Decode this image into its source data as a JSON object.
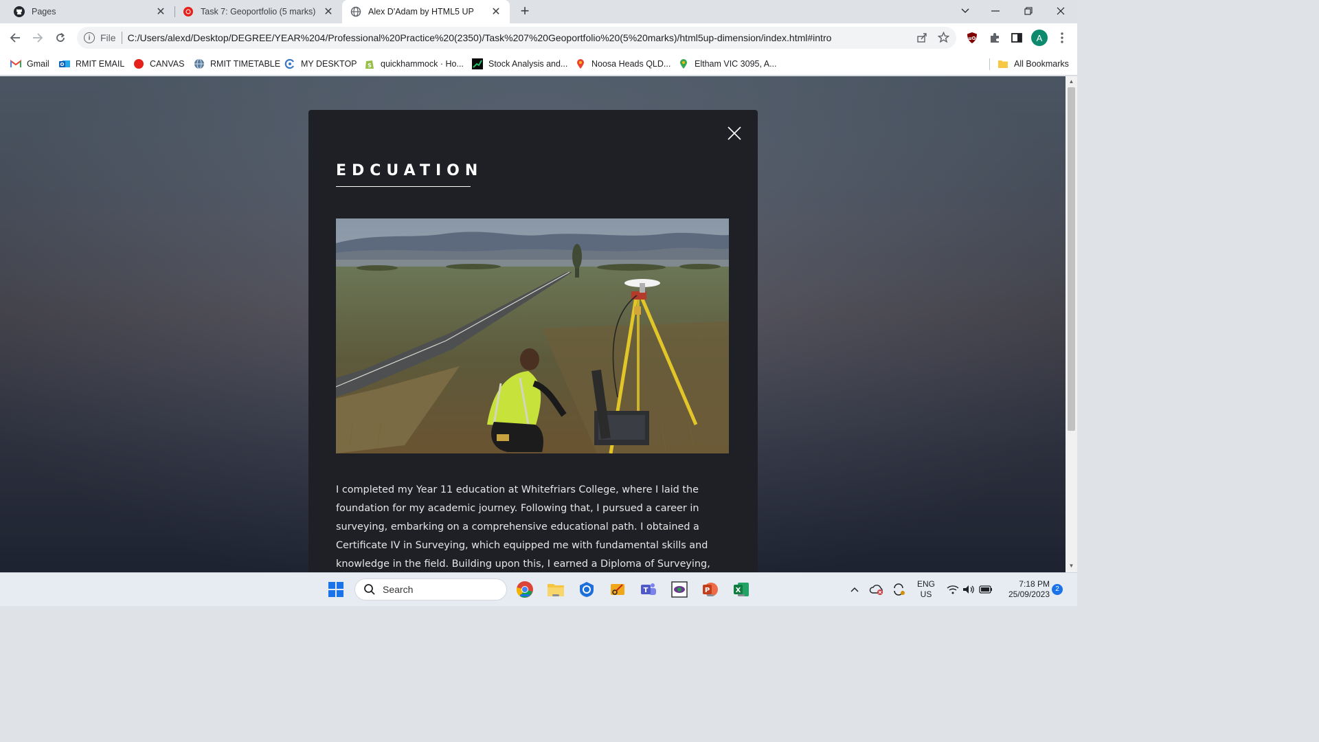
{
  "browser": {
    "tabs": [
      {
        "label": "Pages",
        "icon": "github-icon"
      },
      {
        "label": "Task 7: Geoportfolio (5 marks)",
        "icon": "canvas-icon"
      },
      {
        "label": "Alex D'Adam by HTML5 UP",
        "icon": "globe-icon"
      }
    ],
    "active_tab": 2,
    "address": {
      "scheme_label": "File",
      "url": "C:/Users/alexd/Desktop/DEGREE/YEAR%204/Professional%20Practice%20(2350)/Task%207%20Geoportfolio%20(5%20marks)/html5up-dimension/index.html#intro"
    },
    "profile_initial": "A",
    "bookmarks": [
      {
        "label": "Gmail",
        "icon": "gmail-icon"
      },
      {
        "label": "RMIT EMAIL",
        "icon": "outlook-icon"
      },
      {
        "label": "CANVAS",
        "icon": "canvas-icon"
      },
      {
        "label": "RMIT TIMETABLE",
        "icon": "globe-icon"
      },
      {
        "label": "MY DESKTOP",
        "icon": "desktop-icon"
      },
      {
        "label": "quickhammock · Ho...",
        "icon": "shopify-icon"
      },
      {
        "label": "Stock Analysis and...",
        "icon": "chart-icon"
      },
      {
        "label": "Noosa Heads QLD...",
        "icon": "maps-pin-icon"
      },
      {
        "label": "Eltham VIC 3095, A...",
        "icon": "maps-pin-icon"
      }
    ],
    "all_bookmarks_label": "All Bookmarks"
  },
  "page": {
    "heading": "EDCUATION",
    "photo_alt": "Surveyor with GNSS receiver on tripod beside rural road",
    "paragraph": "I completed my Year 11 education at Whitefriars College, where I laid the foundation for my academic journey. Following that, I pursued a career in surveying, embarking on a comprehensive educational path. I obtained a Certificate IV in Surveying, which equipped me with fundamental skills and knowledge in the field. Building upon this, I earned a Diploma of Surveying, honing my expertise in land measurement and spatial"
  },
  "taskbar": {
    "search_placeholder": "Search",
    "language": "ENG",
    "region": "US",
    "time": "7:18 PM",
    "date": "25/09/2023",
    "notification_count": "2"
  },
  "colors": {
    "article_bg": "#1e2026",
    "heading": "#ffffff",
    "body_text": "#e6e6e6",
    "accent_blue": "#1a73e8"
  }
}
